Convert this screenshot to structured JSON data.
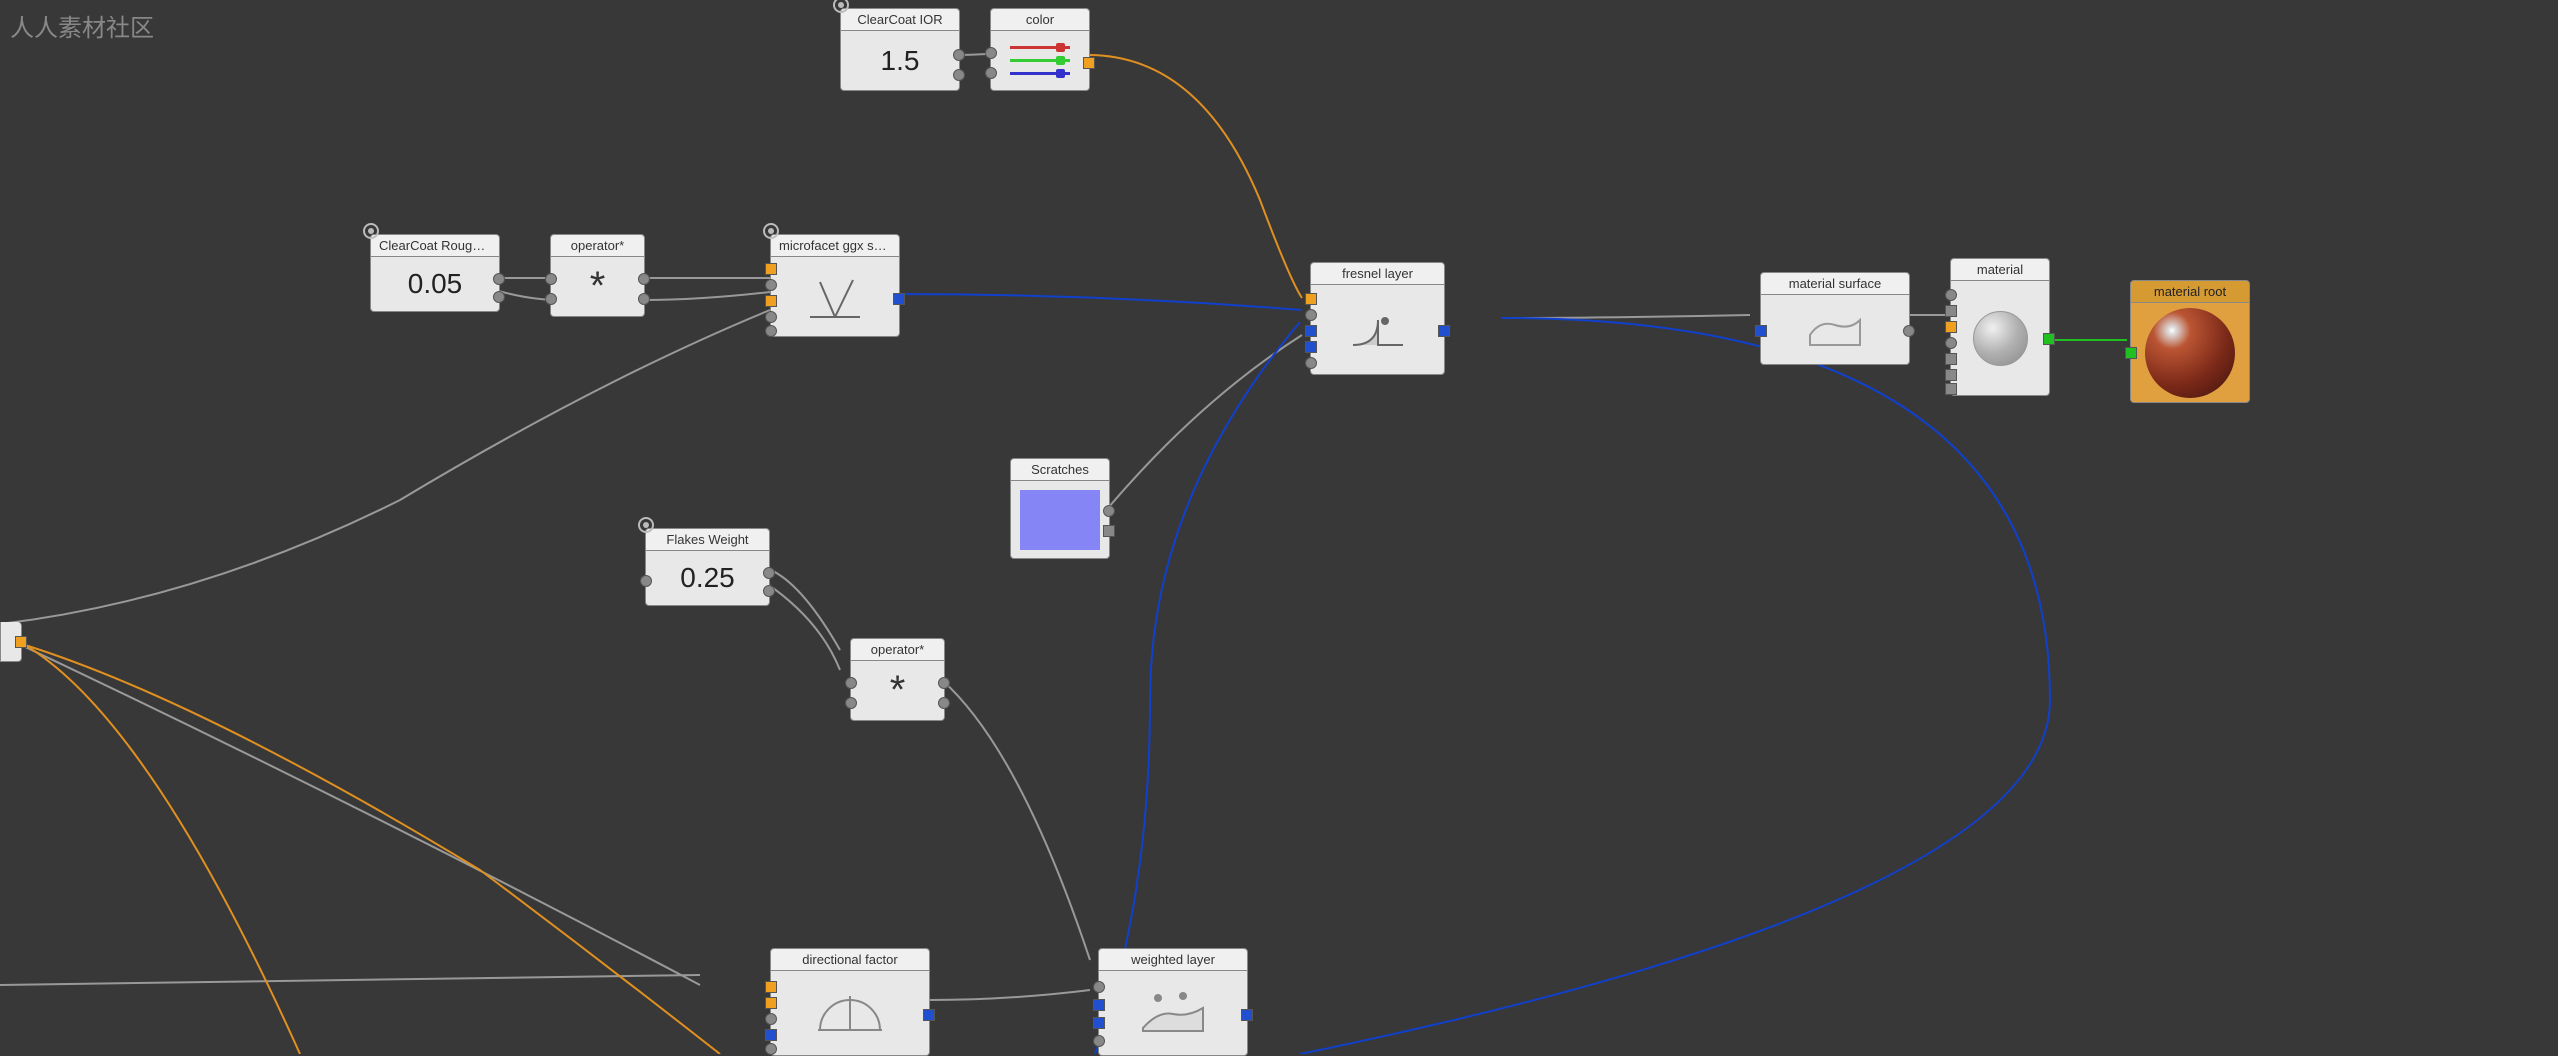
{
  "watermark": "人人素材社区",
  "nodes": {
    "clearcoat_ior": {
      "title": "ClearCoat IOR",
      "value": "1.5"
    },
    "color": {
      "title": "color"
    },
    "clearcoat_roughness": {
      "title": "ClearCoat Roughn...",
      "value": "0.05"
    },
    "operator1": {
      "title": "operator*"
    },
    "microfacet": {
      "title": "microfacet ggx sm..."
    },
    "fresnel_layer": {
      "title": "fresnel layer"
    },
    "material_surface": {
      "title": "material surface"
    },
    "material": {
      "title": "material"
    },
    "material_root": {
      "title": "material root"
    },
    "scratches": {
      "title": "Scratches"
    },
    "flakes_weight": {
      "title": "Flakes Weight",
      "value": "0.25"
    },
    "operator2": {
      "title": "operator*"
    },
    "directional_factor": {
      "title": "directional factor"
    },
    "weighted_layer": {
      "title": "weighted layer"
    }
  }
}
